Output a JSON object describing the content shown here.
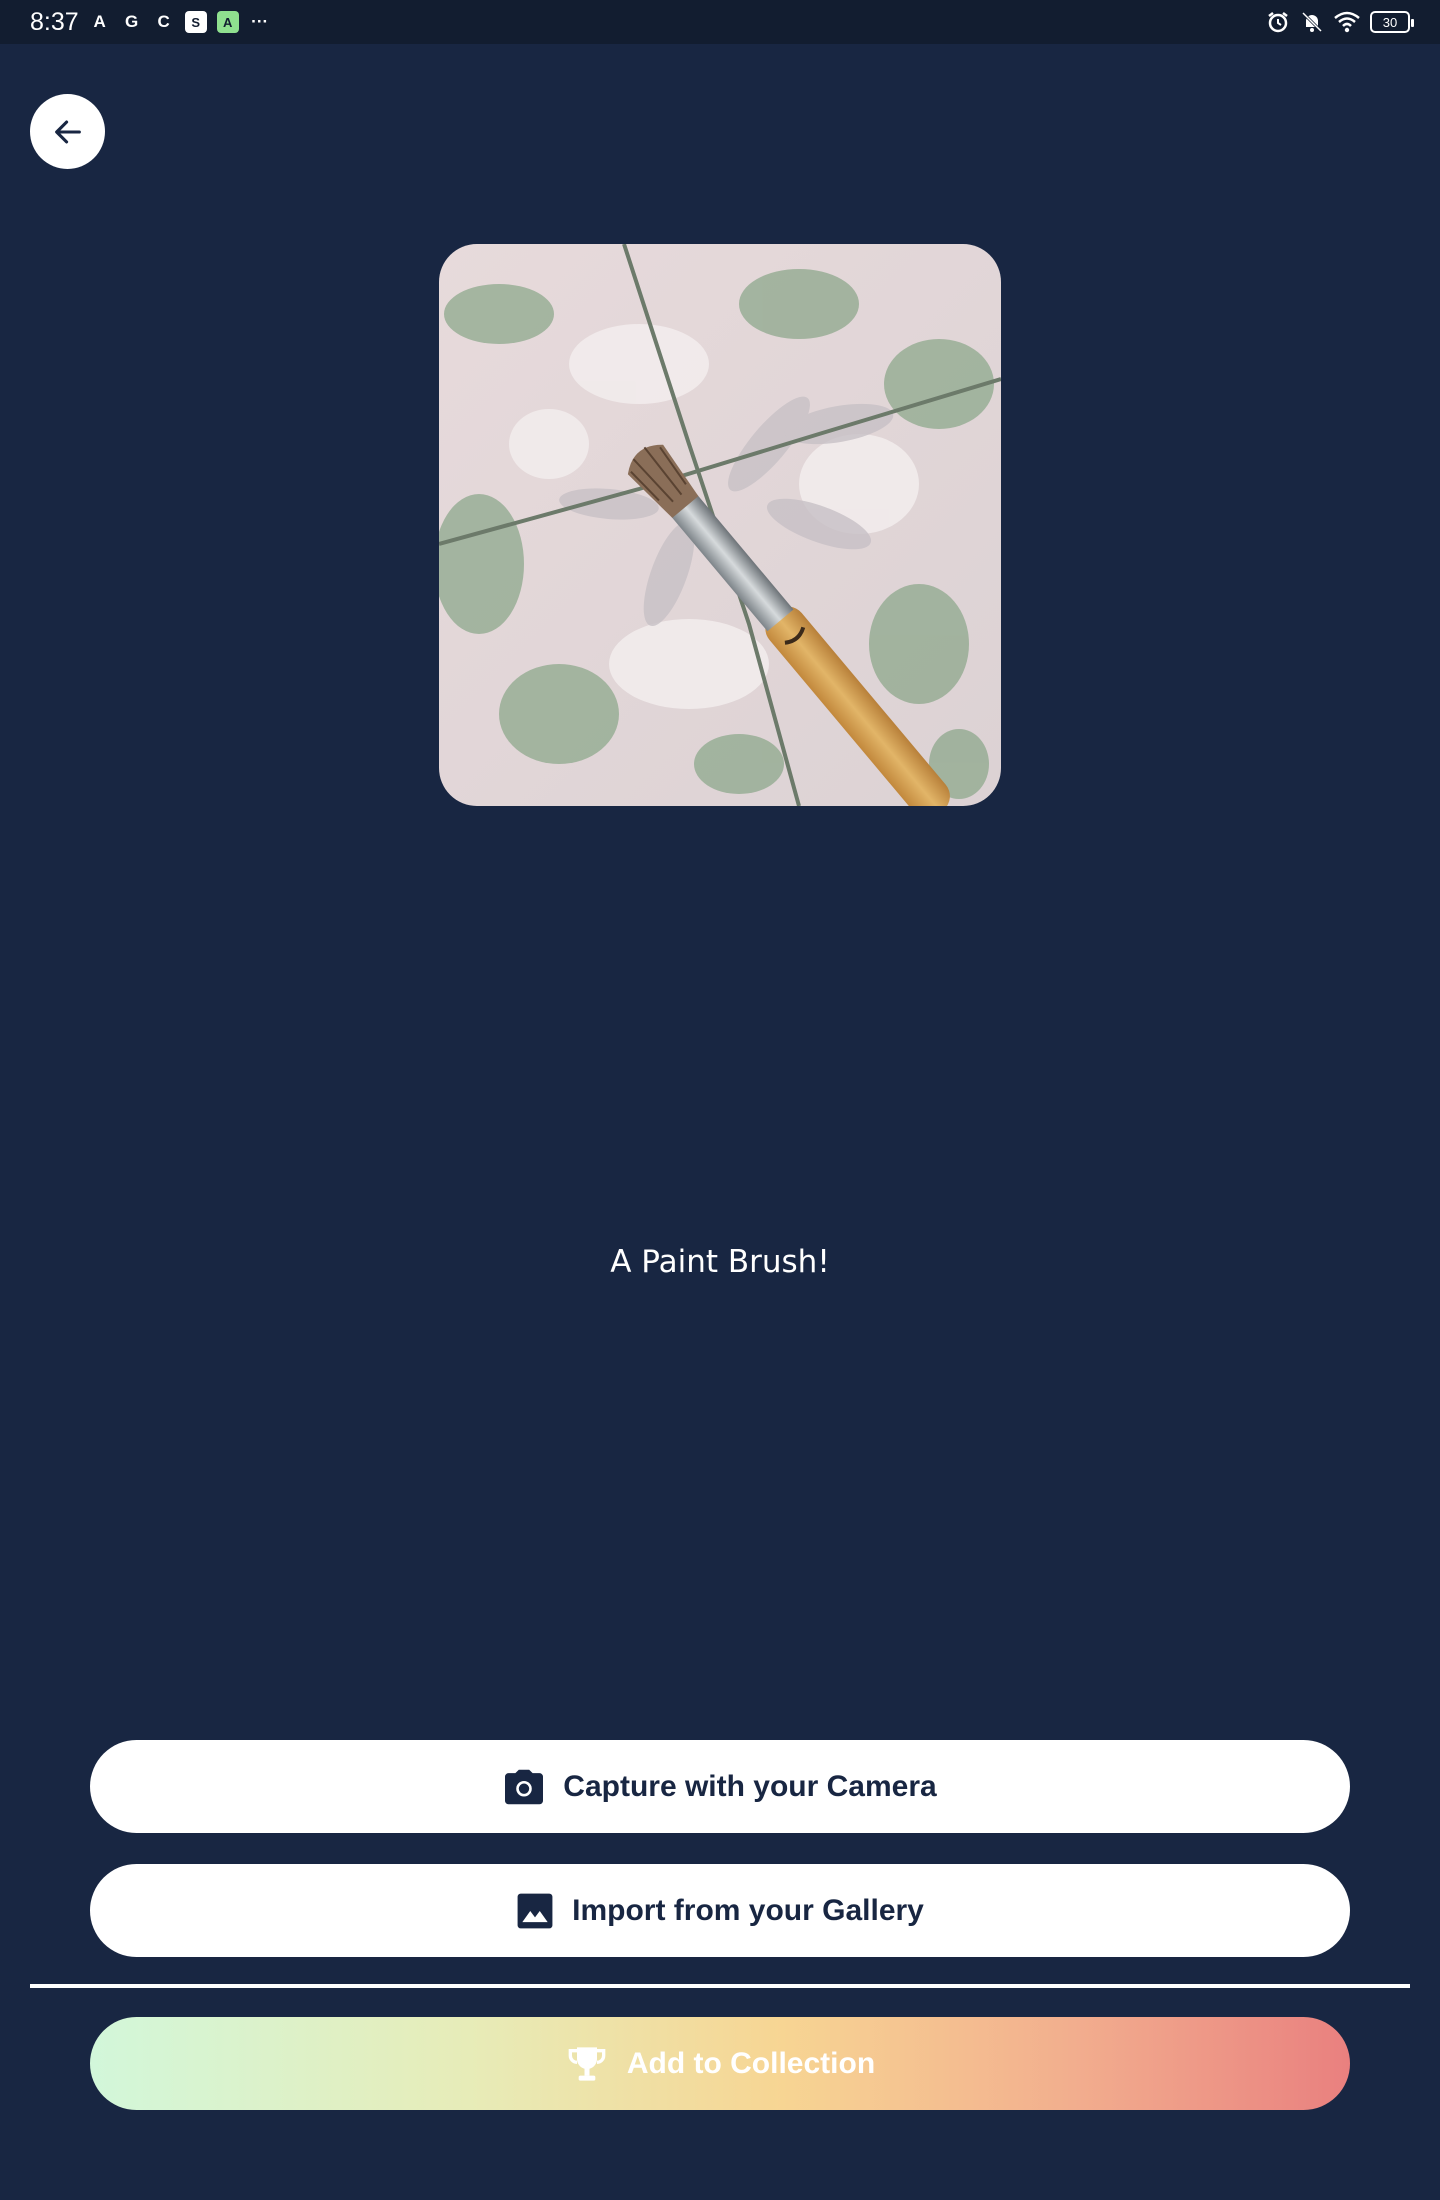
{
  "status_bar": {
    "time": "8:37",
    "notification_icons": [
      "A",
      "G",
      "C",
      "S",
      "A"
    ],
    "more": "···",
    "battery": "30"
  },
  "photo": {
    "subject": "paint brush on tiled floor"
  },
  "result": {
    "caption": "A Paint Brush!"
  },
  "actions": {
    "camera_label": "Capture with your Camera",
    "gallery_label": "Import from your Gallery",
    "collection_label": "Add to Collection"
  },
  "colors": {
    "background": "#182642",
    "status_bar": "#121d30",
    "button_bg": "#ffffff",
    "button_text": "#182642",
    "gradient": [
      "#d2f7da",
      "#e7ecb8",
      "#f7d593",
      "#f2ae8e",
      "#e9807f"
    ]
  },
  "icons": {
    "back": "arrow-left-icon",
    "camera": "camera-icon",
    "gallery": "image-icon",
    "collection": "trophy-icon"
  }
}
